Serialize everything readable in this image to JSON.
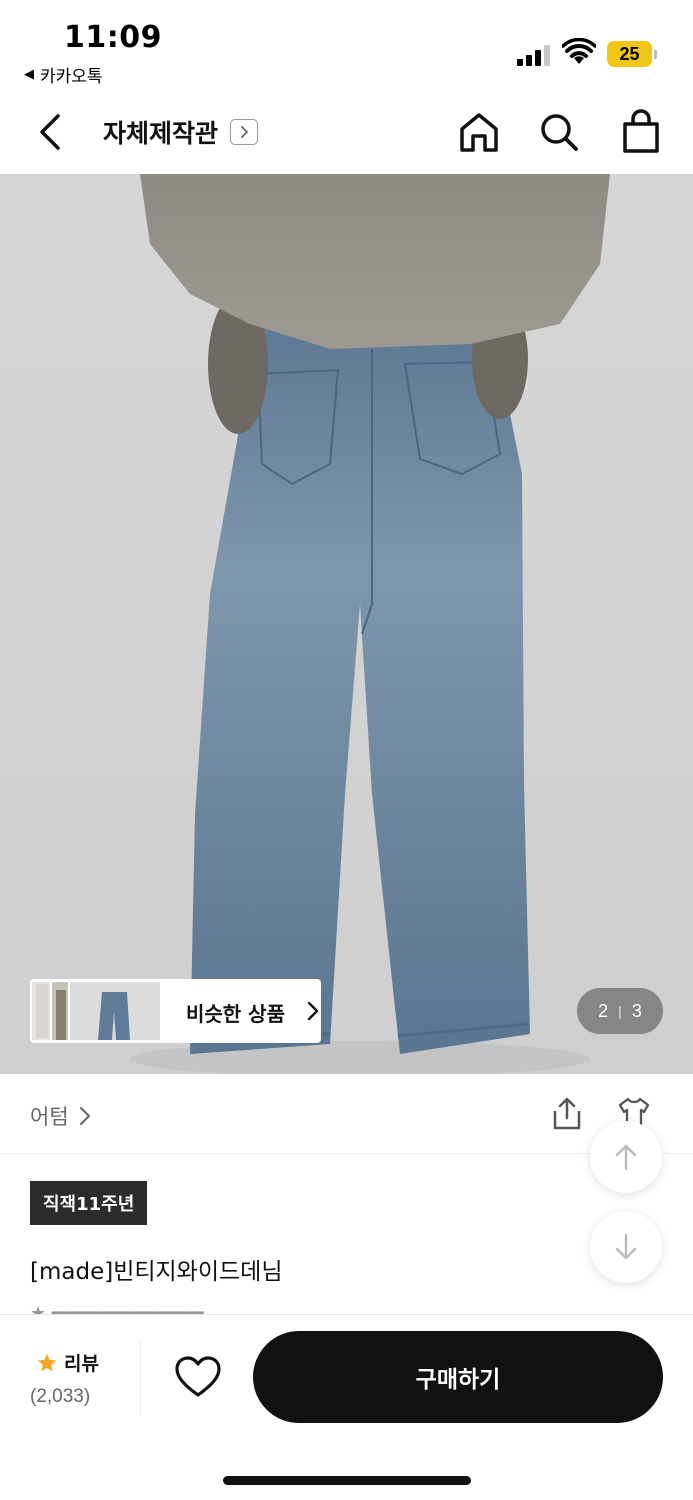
{
  "status_bar": {
    "time": "11:09",
    "back_app": "카카오톡",
    "battery": "25",
    "battery_color": "#f2c614"
  },
  "nav": {
    "title": "자체제작관",
    "icons": [
      "back-icon",
      "chevron-right-icon",
      "home-icon",
      "search-icon",
      "shopping-bag-icon"
    ]
  },
  "product_image": {
    "similar_label": "비슷한 상품",
    "page_current": "2",
    "page_separator": "|",
    "page_total": "3"
  },
  "brand": {
    "name": "어텀",
    "icons": [
      "share-icon",
      "tshirt-icon"
    ]
  },
  "product": {
    "badge": "직잭11주년",
    "name": "[made]빈티지와이드데님"
  },
  "bottom_bar": {
    "review_label": "리뷰",
    "review_count": "(2,033)",
    "buy_label": "구매하기",
    "buy_color": "#111111",
    "star_color": "#f5a623"
  }
}
